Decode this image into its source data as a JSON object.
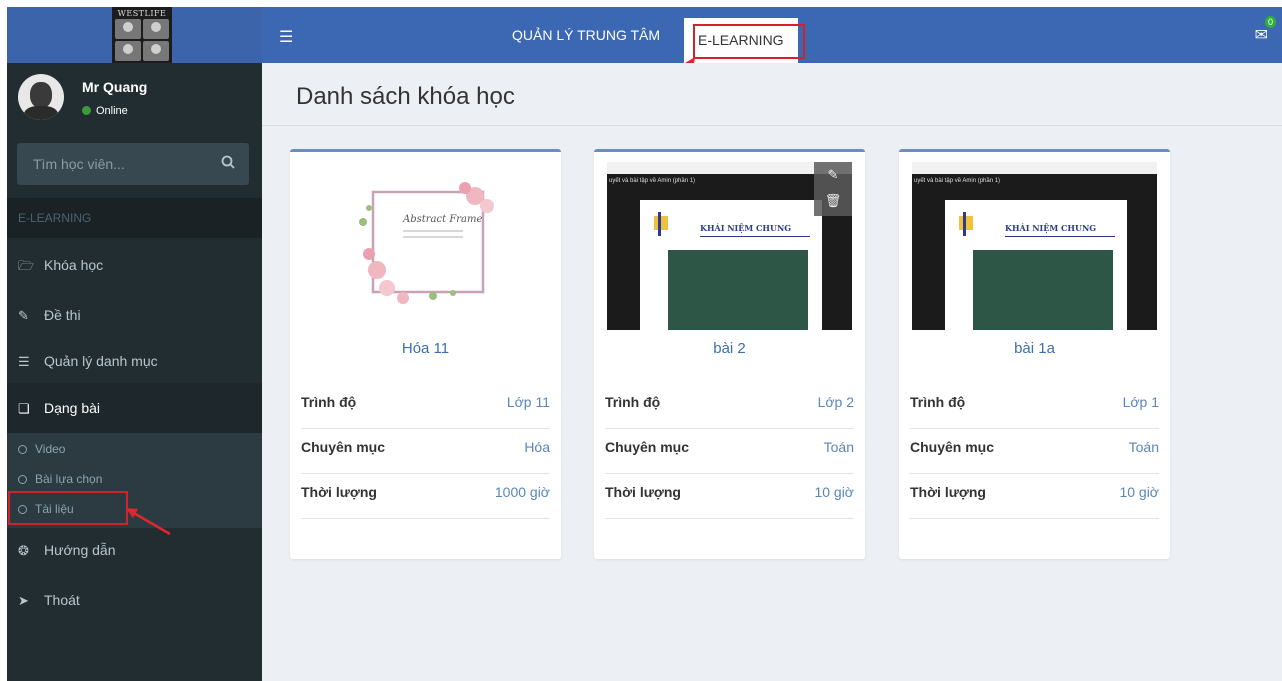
{
  "header": {
    "logo_text": "WESTLIFE",
    "nav": [
      {
        "label": "QUẢN LÝ TRUNG TÂM"
      },
      {
        "label": "E-LEARNING"
      }
    ],
    "mail_count": "0"
  },
  "sidebar": {
    "user_name": "Mr Quang",
    "user_status": "Online",
    "search_placeholder": "Tìm học viên...",
    "section_label": "E-LEARNING",
    "items": [
      {
        "label": "Khóa học",
        "icon": "folder-open-icon"
      },
      {
        "label": "Đề thi",
        "icon": "edit-icon"
      },
      {
        "label": "Quản lý danh mục",
        "icon": "list-icon"
      },
      {
        "label": "Dạng bài",
        "icon": "copy-icon"
      },
      {
        "label": "Hướng dẫn",
        "icon": "life-ring-icon"
      },
      {
        "label": "Thoát",
        "icon": "sign-out-icon"
      }
    ],
    "subitems": [
      {
        "label": "Video"
      },
      {
        "label": "Bài lựa chọn"
      },
      {
        "label": "Tài liệu"
      }
    ]
  },
  "main": {
    "title": "Danh sách khóa học",
    "field_labels": {
      "level": "Trình độ",
      "category": "Chuyên mục",
      "duration": "Thời lượng"
    },
    "courses": [
      {
        "title": "Hóa 11",
        "level": "Lớp 11",
        "category": "Hóa",
        "duration": "1000 giờ",
        "thumb_text": "Abstract Frame"
      },
      {
        "title": "bài 2",
        "level": "Lớp 2",
        "category": "Toán",
        "duration": "10 giờ",
        "video_caption": "uyết và bài tập về Amin (phần 1)",
        "slide_title": "KHÁI NIỆM CHUNG"
      },
      {
        "title": "bài 1a",
        "level": "Lớp 1",
        "category": "Toán",
        "duration": "10 giờ",
        "video_caption": "uyết và bài tập về Amin (phần 1)",
        "slide_title": "KHÁI NIỆM CHUNG"
      }
    ]
  },
  "colors": {
    "header": "#3c67b3",
    "sidebar": "#222d32",
    "accent_link": "#3e6fa8",
    "annotation": "#d2222a"
  }
}
